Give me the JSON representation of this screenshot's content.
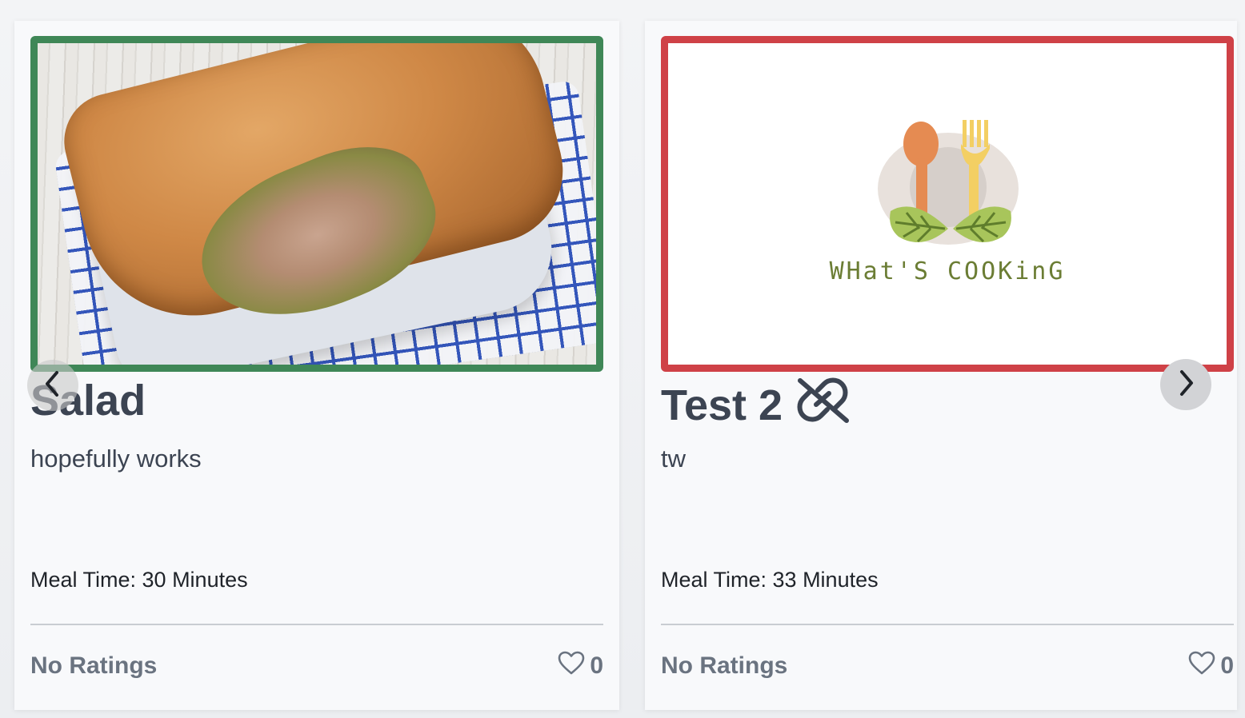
{
  "cards": [
    {
      "title": "Salad",
      "description": "hopefully works",
      "meal_time": "Meal Time: 30 Minutes",
      "ratings": "No Ratings",
      "likes": "0",
      "image": "pie-photo",
      "border_color": "#3f8757"
    },
    {
      "title": "Test 2",
      "title_icon": "link-broken-icon",
      "description": "tw",
      "meal_time": "Meal Time: 33 Minutes",
      "ratings": "No Ratings",
      "likes": "0",
      "image": "whats-cooking-logo",
      "logo_text": "WHat'S COOKinG",
      "border_color": "#cf4147"
    }
  ],
  "nav": {
    "prev_icon": "chevron-left-icon",
    "next_icon": "chevron-right-icon"
  },
  "colors": {
    "card_background": "#f8f9fb",
    "title_text": "#3c4452",
    "muted_text": "#6a7380",
    "success_border": "#3f8757",
    "error_border": "#cf4147"
  }
}
